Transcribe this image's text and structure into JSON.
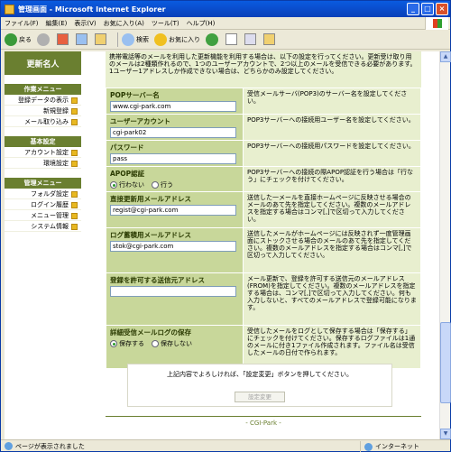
{
  "window": {
    "title": "管理画面 - Microsoft Internet Explorer",
    "minimize": "_",
    "maximize": "□",
    "close": "×"
  },
  "menu": [
    "ファイル(F)",
    "編集(E)",
    "表示(V)",
    "お気に入り(A)",
    "ツール(T)",
    "ヘルプ(H)"
  ],
  "toolbar": {
    "back": "戻る",
    "search": "検索",
    "favorites": "お気に入り"
  },
  "sidebar": {
    "title": "更新名人",
    "sections": [
      {
        "heading": "作業メニュー",
        "items": [
          "登録データの表示",
          "新規登録",
          "メール取り込み"
        ]
      },
      {
        "heading": "基本設定",
        "items": [
          "アカウント設定",
          "環境設定"
        ]
      },
      {
        "heading": "管理メニュー",
        "items": [
          "フォルダ設定",
          "ログイン履歴",
          "メニュー管理",
          "システム情報"
        ]
      }
    ]
  },
  "notice": "携帯電話等のメールを利用した更新機能を利用する場合は、以下の設定を行ってください。更新受け取り用のメールは2種類作れるので、1つのユーザーアカウントで、2つ以上のメールを受信できる必要があります。1ユーザー1アドレスしか作成できない場合は、どちらかのみ設定してください。",
  "form": {
    "pop_server": {
      "label": "POPサーバー名",
      "value": "www.cgi-park.com",
      "desc": "受信メールサーバ(POP3)のサーバー名を設定してください。"
    },
    "user_account": {
      "label": "ユーザーアカウント",
      "value": "cgi-park02",
      "desc": "POP3サーバーへの接続用ユーザー名を設定してください。"
    },
    "password": {
      "label": "パスワード",
      "value": "pass",
      "desc": "POP3サーバーへの接続用パスワードを設定してください。"
    },
    "apop": {
      "label": "APOP認証",
      "opt_yes": "行わない",
      "opt_no": "行う",
      "desc": "POP3サーバーへの接続の際APOP認証を行う場合は「行なう」にチェックを付けてください。"
    },
    "direct_mail": {
      "label": "直接更新用メールアドレス",
      "value": "regist@cgi-park.com",
      "desc": "送信した一メールを直接ホームページに反映させる場合のメールのあて先を指定してください。複数のメールアドレスを指定する場合はコンマ[,]で区切って入力してください。"
    },
    "log_mail": {
      "label": "ログ蓄積用メールアドレス",
      "value": "stok@cgi-park.com",
      "desc": "送信したメールがホームページには反映されず一度管理画面にストックさせる場合のメールのあて先を指定してください。複数のメールアドレスを指定する場合はコンマ[,]で区切って入力してください。"
    },
    "allowed_senders": {
      "label": "登録を許可する送信元アドレス",
      "value": "",
      "desc": "メール更新で、登録を許可する送信元のメールアドレス(FROM)を指定してください。複数のメールアドレスを指定する場合は、コンマ[,]で区切って入力してください。何も入力しないと、すべてのメールアドレスで登録可能になります。"
    },
    "log_save": {
      "label": "詳細受信メールログの保存",
      "opt_yes": "保存する",
      "opt_no": "保存しない",
      "desc": "受信したメールをログとして保存する場合は「保存する」にチェックを付けてください。保存するログファイルは1通のメールに付き1ファイル作成されます。ファイル名は受信したメールの日付で作られます。"
    }
  },
  "confirm": {
    "text": "上記内容でよろしければ、「設定変更」ボタンを押してください。",
    "button": "設定変更"
  },
  "footer": "- CGI-Park -",
  "status": {
    "text": "ページが表示されました",
    "zone": "インターネット"
  }
}
